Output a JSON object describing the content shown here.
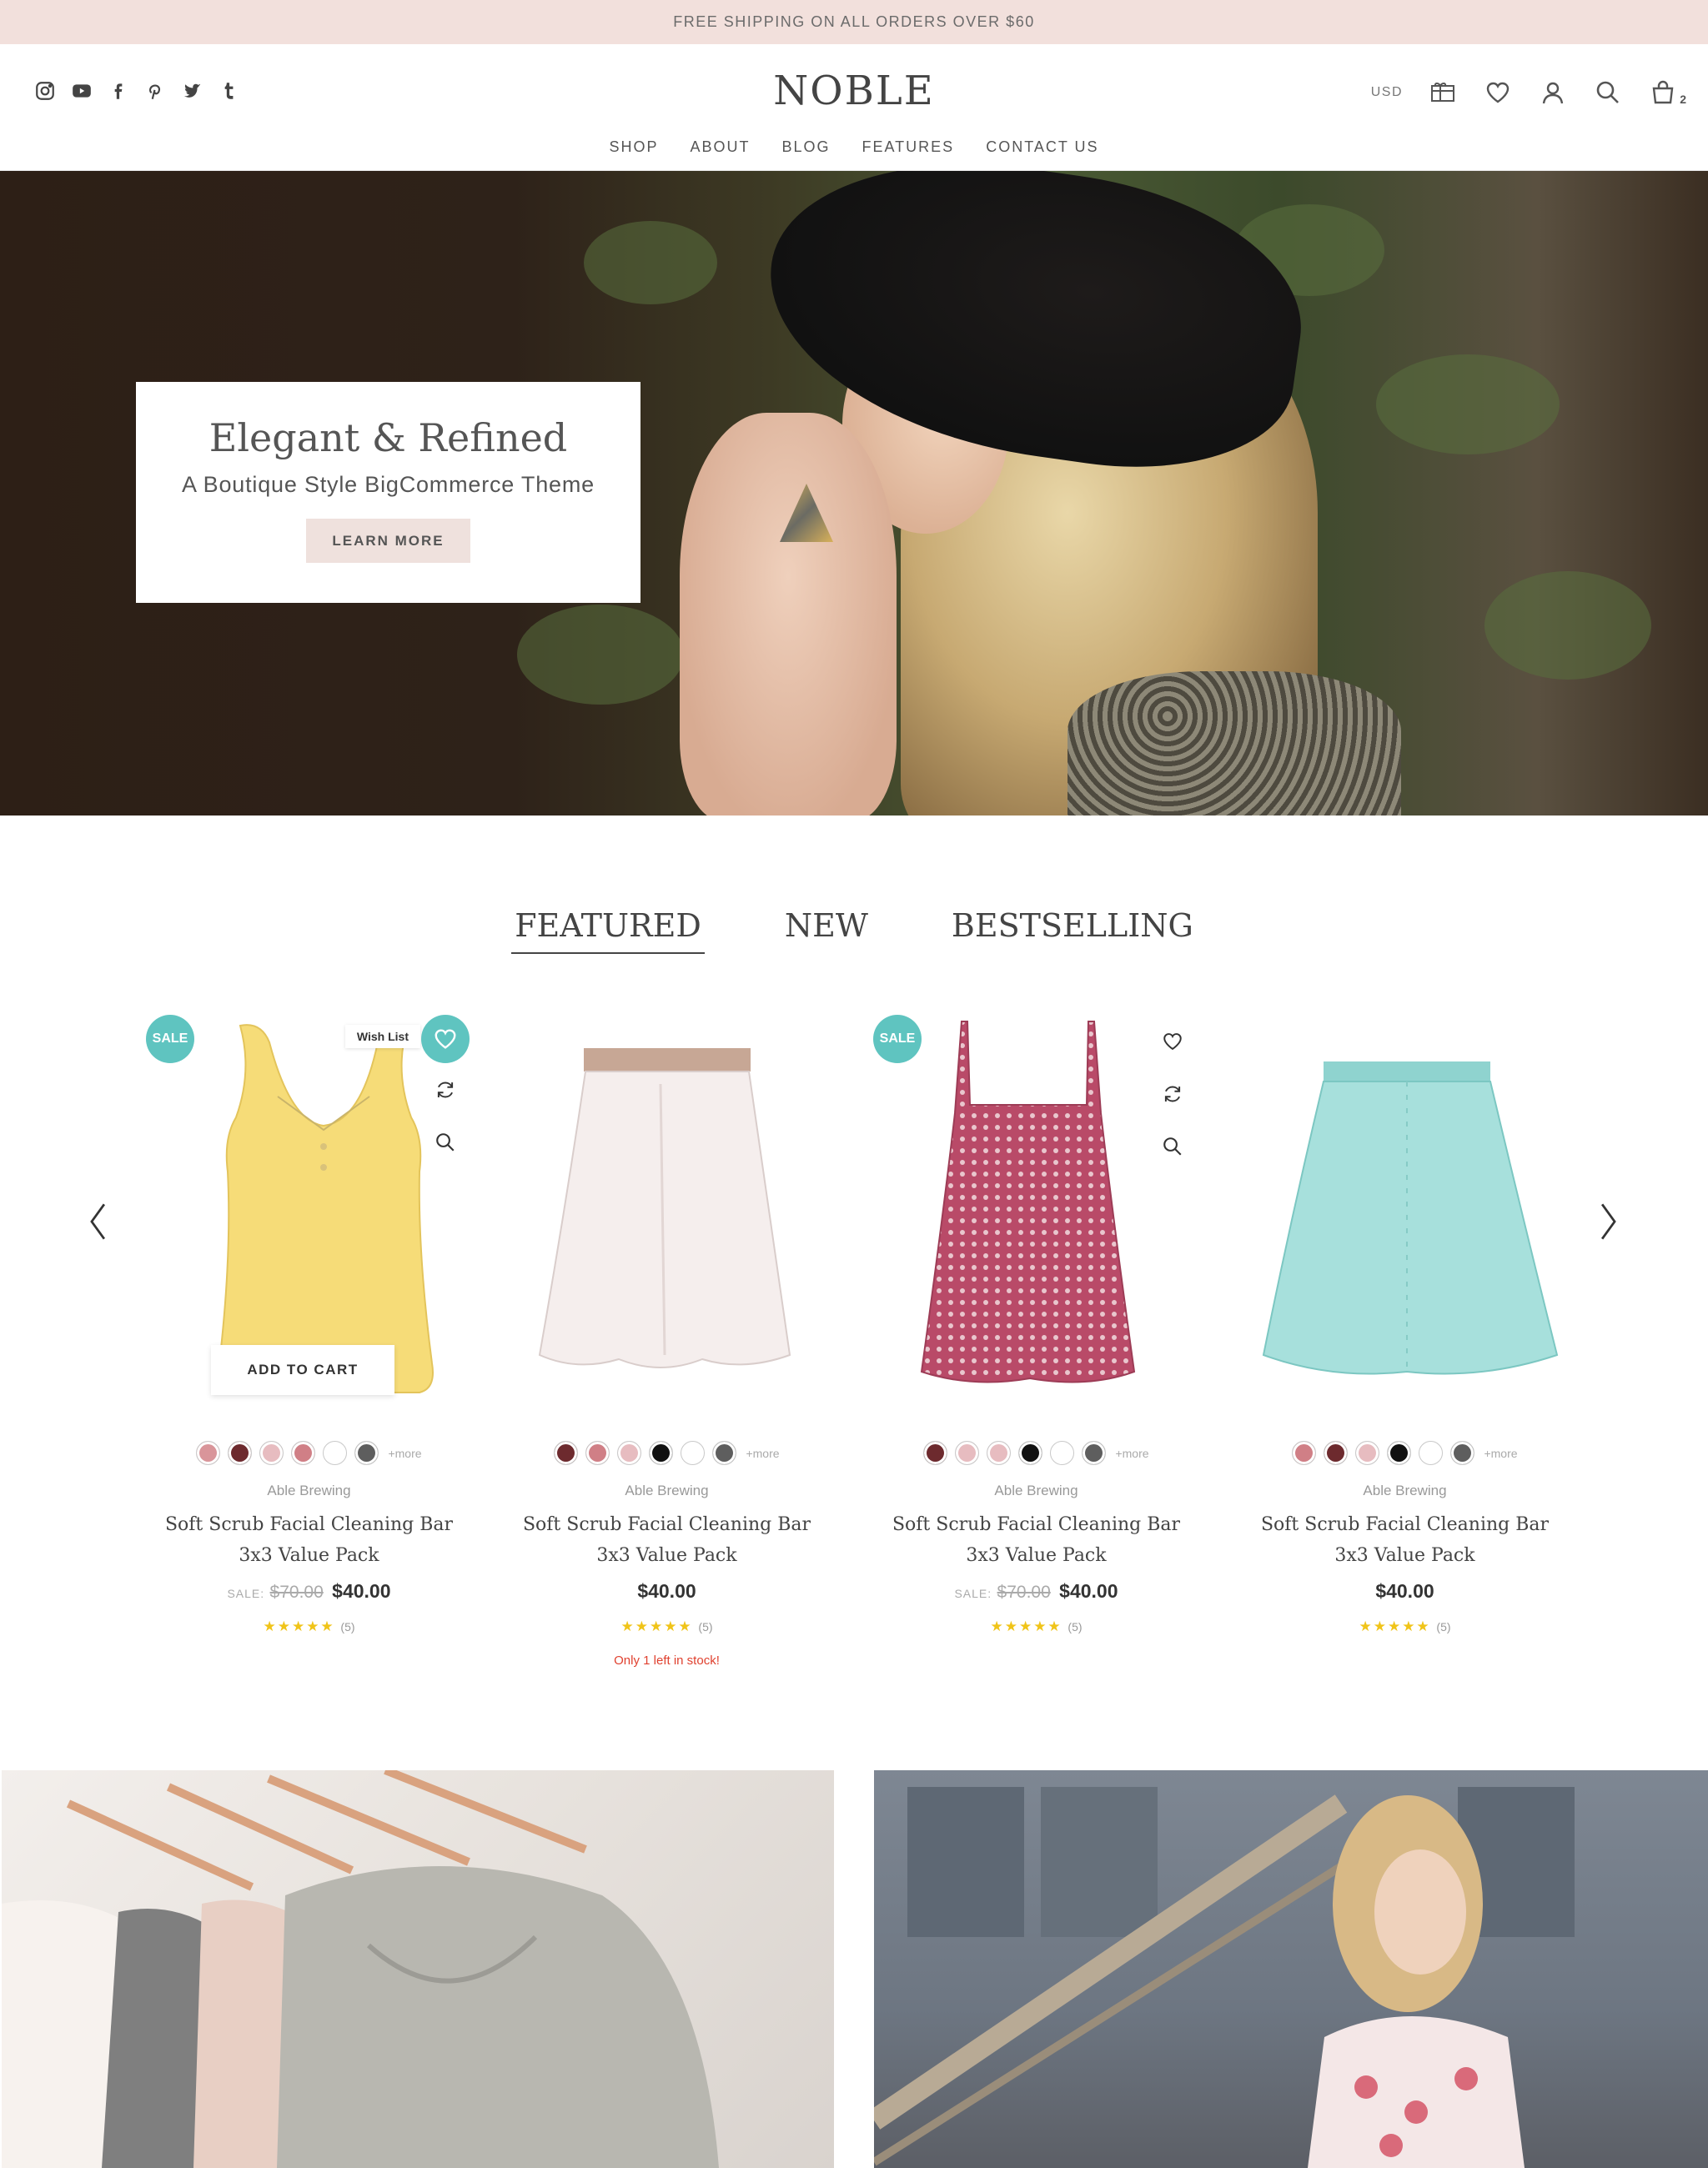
{
  "promo": {
    "text": "FREE SHIPPING ON ALL ORDERS OVER $60"
  },
  "header": {
    "logo": "NOBLE",
    "currency": "USD",
    "cart_count": "2",
    "social_icons": [
      "instagram-icon",
      "youtube-icon",
      "facebook-icon",
      "pinterest-icon",
      "twitter-icon",
      "tumblr-icon"
    ],
    "util_icons": [
      "gift-certificate-icon",
      "wishlist-heart-icon",
      "account-icon",
      "search-icon",
      "cart-bag-icon"
    ]
  },
  "nav": {
    "items": [
      "SHOP",
      "ABOUT",
      "BLOG",
      "FEATURES",
      "CONTACT US"
    ]
  },
  "hero": {
    "title": "Elegant & Refined",
    "subtitle": "A Boutique Style BigCommerce Theme",
    "button": "LEARN MORE"
  },
  "tabs": {
    "items": [
      "FEATURED",
      "NEW",
      "BESTSELLING"
    ],
    "active": "FEATURED"
  },
  "colors": {
    "accent": "#5fc4c0",
    "promo_bg": "#f2e0dc",
    "button_bg": "#efe1dd",
    "stock_red": "#e0412f",
    "star": "#f0c419"
  },
  "products": [
    {
      "badge": "SALE",
      "wishlist_tip": "Wish List",
      "add_to_cart": "ADD TO CART",
      "swatches": [
        "#d9959a",
        "#6d2a2e",
        "#e7bcc0",
        "#d07f86",
        "#ffffff",
        "#5e5e5e"
      ],
      "more": "+more",
      "brand": "Able Brewing",
      "title_line1": "Soft Scrub Facial Cleaning Bar",
      "title_line2": "3x3 Value Pack",
      "sale_label": "SALE:",
      "old_price": "$70.00",
      "price": "$40.00",
      "stars": "★★★★★",
      "rating_count": "(5)",
      "stock": ""
    },
    {
      "badge": "",
      "swatches": [
        "#6d2a2e",
        "#d07f86",
        "#e7bcc0",
        "#111111",
        "#ffffff",
        "#5e5e5e"
      ],
      "more": "+more",
      "brand": "Able Brewing",
      "title_line1": "Soft Scrub Facial Cleaning Bar",
      "title_line2": "3x3 Value Pack",
      "sale_label": "",
      "old_price": "",
      "price": "$40.00",
      "stars": "★★★★★",
      "rating_count": "(5)",
      "stock": "Only 1 left in stock!"
    },
    {
      "badge": "SALE",
      "swatches": [
        "#6d2a2e",
        "#e7bcc0",
        "#e7bcc0",
        "#111111",
        "#ffffff",
        "#5e5e5e"
      ],
      "more": "+more",
      "brand": "Able Brewing",
      "title_line1": "Soft Scrub Facial Cleaning Bar",
      "title_line2": "3x3 Value Pack",
      "sale_label": "SALE:",
      "old_price": "$70.00",
      "price": "$40.00",
      "stars": "★★★★★",
      "rating_count": "(5)",
      "stock": ""
    },
    {
      "badge": "",
      "swatches": [
        "#d07f86",
        "#6d2a2e",
        "#e7bcc0",
        "#111111",
        "#ffffff",
        "#5e5e5e"
      ],
      "more": "+more",
      "brand": "Able Brewing",
      "title_line1": "Soft Scrub Facial Cleaning Bar",
      "title_line2": "3x3 Value Pack",
      "sale_label": "",
      "old_price": "",
      "price": "$40.00",
      "stars": "★★★★★",
      "rating_count": "(5)",
      "stock": ""
    }
  ]
}
